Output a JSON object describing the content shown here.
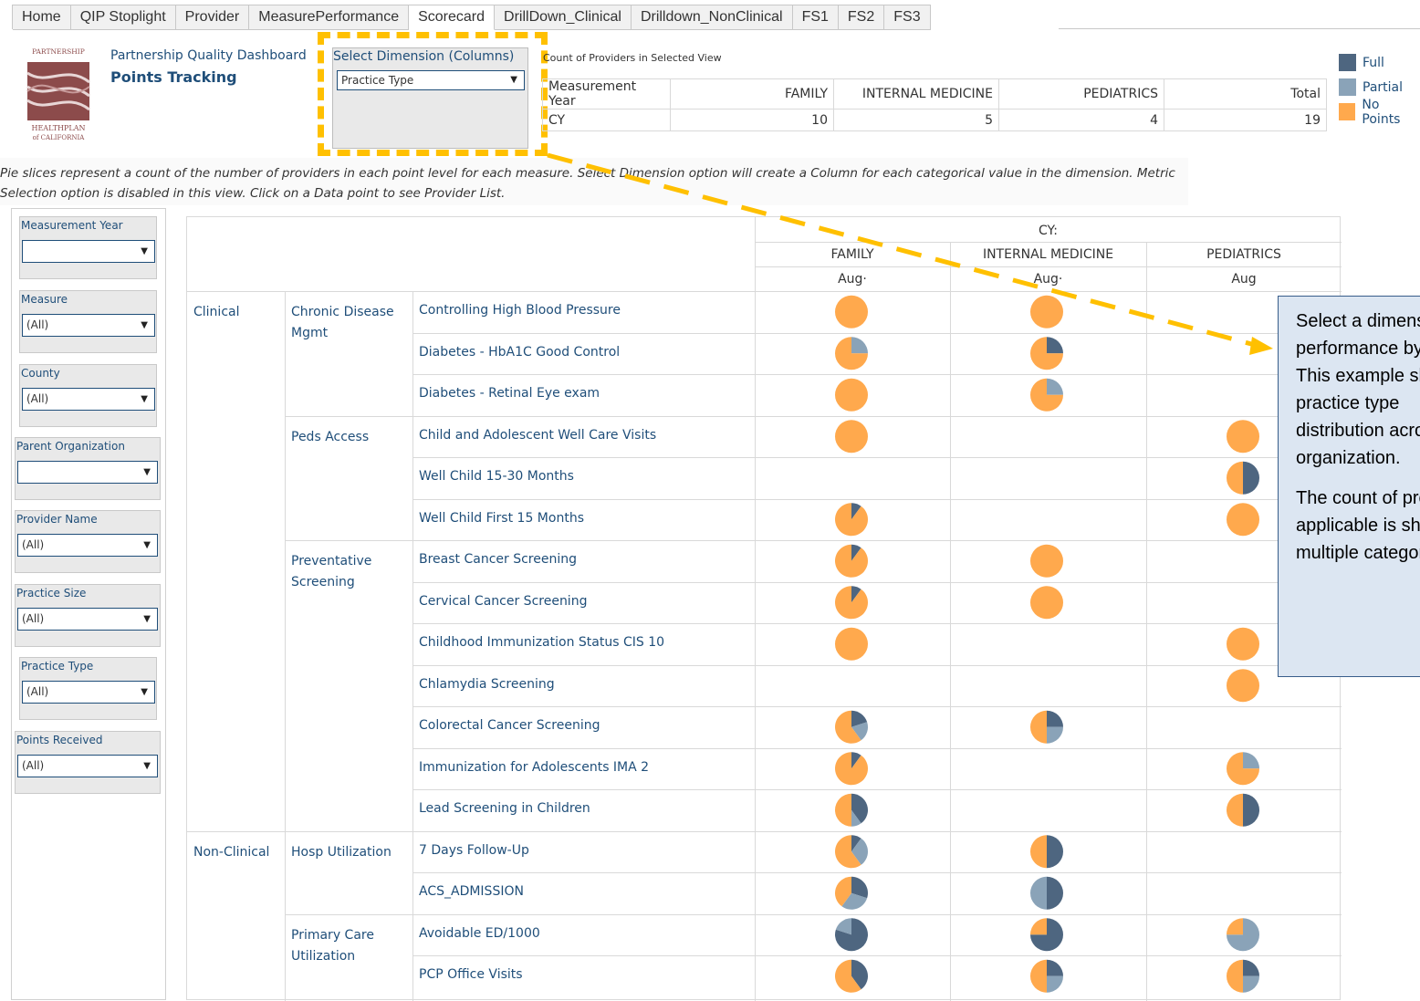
{
  "tabs": [
    "Home",
    "QIP Stoplight",
    "Provider",
    "MeasurePerformance",
    "Scorecard",
    "DrillDown_Clinical",
    "Drilldown_NonClinical",
    "FS1",
    "FS2",
    "FS3"
  ],
  "active_tab": "Scorecard",
  "header": {
    "title": "Partnership Quality Dashboard",
    "subtitle": "Points Tracking",
    "logo_text": "PARTNERSHIP HEALTHPLAN of CALIFORNIA"
  },
  "select_dimension": {
    "label": "Select Dimension (Columns)",
    "value": "Practice Type"
  },
  "count_table": {
    "caption": "Count of Providers in Selected View",
    "headers": [
      "Measurement Year",
      "FAMILY",
      "INTERNAL MEDICINE",
      "PEDIATRICS",
      "Total"
    ],
    "row": [
      "CY",
      "10",
      "5",
      "4",
      "19"
    ]
  },
  "legend": [
    {
      "label": "Full",
      "color": "#4e6680"
    },
    {
      "label": "Partial",
      "color": "#8aa3b8"
    },
    {
      "label": "No Points",
      "color": "#ffa94d"
    }
  ],
  "description": "Pie slices represent a count of the number of providers in each point level for each measure. Select Dimension option will create a Column for each categorical value in the dimension. Metric Selection option is disabled in this view.  Click on a Data point to see Provider List.",
  "filters": [
    {
      "label": "Measurement Year",
      "value": ""
    },
    {
      "label": "Measure",
      "value": "(All)"
    },
    {
      "label": "County",
      "value": "(All)"
    },
    {
      "label": "Parent Organization",
      "value": ""
    },
    {
      "label": "Provider Name",
      "value": "(All)"
    },
    {
      "label": "Practice Size",
      "value": "(All)"
    },
    {
      "label": "Practice Type",
      "value": "(All)"
    },
    {
      "label": "Points Received",
      "value": "(All)"
    }
  ],
  "scorecard": {
    "year_header": "CY:",
    "columns": [
      "FAMILY",
      "INTERNAL MEDICINE",
      "PEDIATRICS"
    ],
    "month_headers": [
      "Aug·",
      "Aug·",
      "Aug"
    ],
    "groups": [
      {
        "label": "Clinical",
        "categories": [
          {
            "label": "Chronic Disease Mgmt",
            "measures": [
              "Controlling High Blood Pressure",
              "Diabetes - HbA1C Good Control",
              "Diabetes - Retinal Eye exam"
            ]
          },
          {
            "label": "Peds Access",
            "measures": [
              "Child and Adolescent Well Care Visits",
              "Well Child 15-30 Months",
              "Well Child First 15 Months"
            ]
          },
          {
            "label": "Preventative Screening",
            "measures": [
              "Breast Cancer Screening",
              "Cervical Cancer Screening",
              "Childhood Immunization Status CIS 10",
              "Chlamydia Screening",
              "Colorectal Cancer Screening",
              "Immunization for Adolescents IMA 2",
              "Lead Screening in Children"
            ]
          }
        ]
      },
      {
        "label": "Non-Clinical",
        "categories": [
          {
            "label": "Hosp Utilization",
            "measures": [
              "7 Days Follow-Up",
              "ACS_ADMISSION"
            ]
          },
          {
            "label": "Primary Care Utilization",
            "measures": [
              "Avoidable ED/1000",
              "PCP Office Visits"
            ]
          }
        ]
      }
    ],
    "pies_note": "each pie: [full, partial, none] share, null = no pie",
    "pies": [
      [
        [
          0,
          0,
          1
        ],
        [
          0,
          0,
          1
        ],
        null
      ],
      [
        [
          0,
          0.25,
          0.75
        ],
        [
          0.25,
          0,
          0.75
        ],
        null
      ],
      [
        [
          0,
          0,
          1
        ],
        [
          0,
          0.25,
          0.75
        ],
        null
      ],
      [
        [
          0,
          0,
          1
        ],
        null,
        [
          0,
          0,
          1
        ]
      ],
      [
        null,
        null,
        [
          0.5,
          0,
          0.5
        ]
      ],
      [
        [
          0.1,
          0,
          0.9
        ],
        null,
        [
          0,
          0,
          1
        ]
      ],
      [
        [
          0.1,
          0,
          0.9
        ],
        [
          0,
          0,
          1
        ],
        null
      ],
      [
        [
          0.1,
          0,
          0.9
        ],
        [
          0,
          0,
          1
        ],
        null
      ],
      [
        [
          0,
          0,
          1
        ],
        null,
        [
          0,
          0,
          1
        ]
      ],
      [
        null,
        null,
        [
          0,
          0,
          1
        ]
      ],
      [
        [
          0.2,
          0.2,
          0.6
        ],
        [
          0.25,
          0.25,
          0.5
        ],
        null
      ],
      [
        [
          0.1,
          0,
          0.9
        ],
        null,
        [
          0,
          0.25,
          0.75
        ]
      ],
      [
        [
          0.4,
          0.1,
          0.5
        ],
        null,
        [
          0.5,
          0,
          0.5
        ]
      ],
      [
        [
          0.1,
          0.3,
          0.6
        ],
        [
          0.5,
          0,
          0.5
        ],
        null
      ],
      [
        [
          0.3,
          0.3,
          0.4
        ],
        [
          0.5,
          0.5,
          0
        ],
        null
      ],
      [
        [
          0.8,
          0.2,
          0
        ],
        [
          0.75,
          0,
          0.25
        ],
        [
          0,
          0.75,
          0.25
        ]
      ],
      [
        [
          0.4,
          0,
          0.6
        ],
        [
          0.25,
          0.25,
          0.5
        ],
        [
          0.25,
          0.25,
          0.5
        ]
      ]
    ]
  },
  "callout": {
    "paragraphs": [
      [
        "Select a dimension to see",
        "performance by category.",
        "This example shows",
        "practice type",
        "distribution across the",
        "organization."
      ],
      [
        "The count of providers",
        "applicable is shown for",
        "multiple categories."
      ]
    ]
  }
}
